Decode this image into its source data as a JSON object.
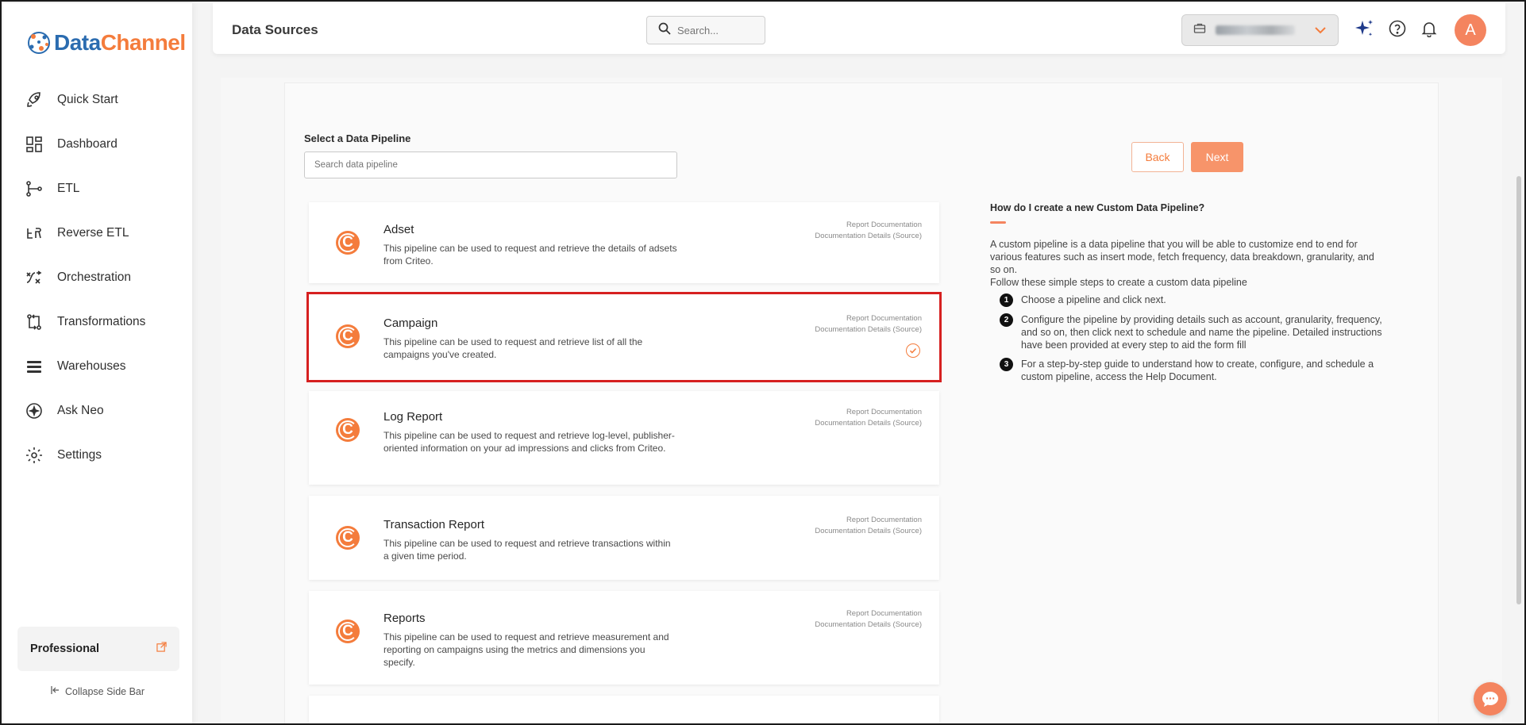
{
  "app": {
    "logo_part1": "Data",
    "logo_part2": "Channel",
    "page_title": "Data Sources"
  },
  "header": {
    "search_placeholder": "Search...",
    "avatar_initial": "A"
  },
  "sidebar": {
    "items": [
      {
        "label": "Quick Start",
        "icon": "rocket-icon"
      },
      {
        "label": "Dashboard",
        "icon": "dashboard-icon"
      },
      {
        "label": "ETL",
        "icon": "etl-icon"
      },
      {
        "label": "Reverse ETL",
        "icon": "reverse-etl-icon"
      },
      {
        "label": "Orchestration",
        "icon": "orchestration-icon"
      },
      {
        "label": "Transformations",
        "icon": "transformations-icon"
      },
      {
        "label": "Warehouses",
        "icon": "warehouses-icon"
      },
      {
        "label": "Ask Neo",
        "icon": "sparkle-icon"
      },
      {
        "label": "Settings",
        "icon": "gear-icon"
      }
    ],
    "plan": "Professional",
    "collapse_label": "Collapse Side Bar"
  },
  "main": {
    "section_label": "Select a Data Pipeline",
    "pipeline_search_placeholder": "Search data pipeline",
    "back_label": "Back",
    "next_label": "Next",
    "link_report_doc": "Report Documentation",
    "link_details": "Documentation Details (Source)",
    "pipelines": [
      {
        "title": "Adset",
        "logo": "C",
        "description": "This pipeline can be used to request and retrieve the details of adsets from Criteo.",
        "selected": false
      },
      {
        "title": "Campaign",
        "logo": "C",
        "description": "This pipeline can be used to request and retrieve list of all the campaigns you've created.",
        "selected": true
      },
      {
        "title": "Log Report",
        "logo": "C",
        "description": "This pipeline can be used to request and retrieve log-level, publisher-oriented information on your ad impressions and clicks from Criteo.",
        "selected": false
      },
      {
        "title": "Transaction Report",
        "logo": "C",
        "description": "This pipeline can be used to request and retrieve transactions within a given time period.",
        "selected": false
      },
      {
        "title": "Reports",
        "logo": "C",
        "description": "This pipeline can be used to request and retrieve measurement and reporting on campaigns using the metrics and dimensions you specify.",
        "selected": false
      }
    ]
  },
  "help": {
    "title": "How do I create a new Custom Data Pipeline?",
    "intro": "A custom pipeline is a data pipeline that you will be able to customize end to end for various features such as insert mode, fetch frequency, data breakdown, granularity, and so on.",
    "sub": "Follow these simple steps to create a custom data pipeline",
    "steps": [
      {
        "num": "1",
        "text": "Choose a pipeline and click next."
      },
      {
        "num": "2",
        "text": "Configure the pipeline by providing details such as account, granularity, frequency, and so on, then click next to schedule and name the pipeline. Detailed instructions have been provided at every step to aid the form fill"
      },
      {
        "num": "3",
        "text": "For a step-by-step guide to understand how to create, configure, and schedule a custom pipeline, access the Help Document."
      }
    ]
  },
  "colors": {
    "accent": "#f47c3c",
    "brand_blue": "#2b6cb0",
    "selected_outline": "#d62020"
  }
}
